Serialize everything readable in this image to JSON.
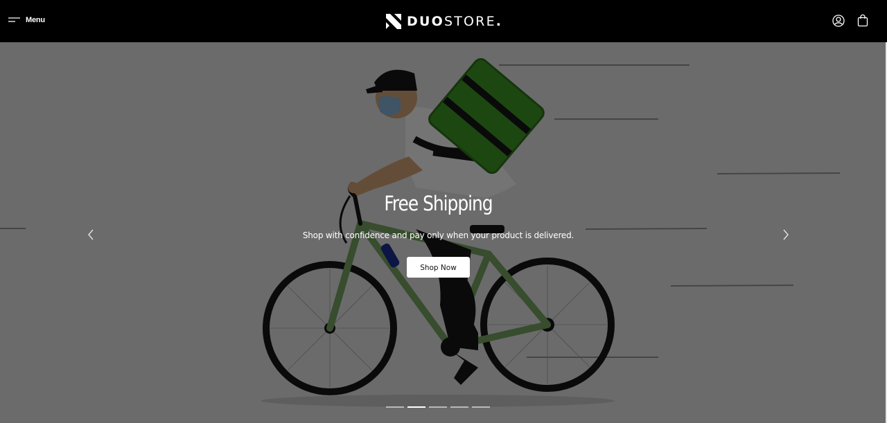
{
  "header": {
    "menu_label": "Menu",
    "logo": {
      "brand_bold": "DUO",
      "brand_regular": "STORE",
      "brand_dot": "."
    },
    "icons": [
      "menu-icon",
      "logo-mark-icon",
      "account-icon",
      "cart-icon"
    ]
  },
  "slider": {
    "slides": [
      {
        "title": "Free Shipping",
        "subtitle": "Shop with confidence and pay only when your product is delivered.",
        "button_label": "Shop Now"
      }
    ],
    "slide_count": 5,
    "active_index": 1,
    "icons": [
      "chevron-left-icon",
      "chevron-right-icon"
    ]
  },
  "colors": {
    "header_bg": "#000000",
    "accent_green": "#3b8f22",
    "bike_frame": "#7fa86a",
    "button_bg": "#ffffff"
  }
}
